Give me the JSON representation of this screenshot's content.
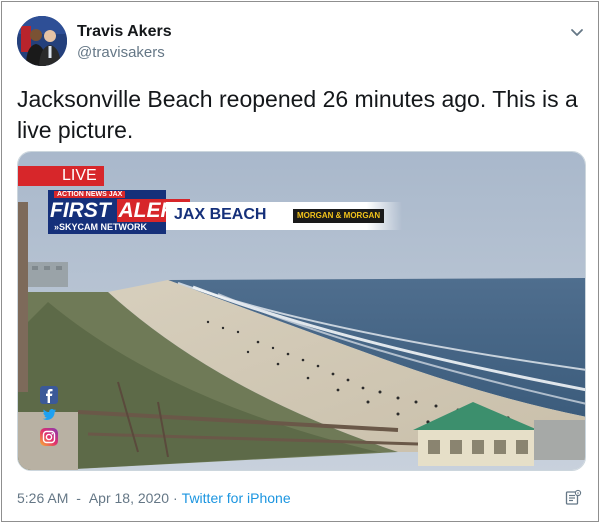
{
  "author": {
    "display_name": "Travis Akers",
    "handle": "@travisakers"
  },
  "tweet": {
    "text": "Jacksonville Beach reopened 26 minutes ago. This is a live picture."
  },
  "media": {
    "live_badge": "LIVE",
    "network_top": "ACTION NEWS JAX",
    "alert_word1": "FIRST",
    "alert_word2": "ALERT",
    "network_bottom": "»SKYCAM NETWORK",
    "location": "JAX BEACH",
    "sponsor": "MORGAN & MORGAN"
  },
  "footer": {
    "time": "5:26 AM",
    "date": "Apr 18, 2020",
    "separator": "·",
    "source": "Twitter for iPhone"
  },
  "colors": {
    "link": "#1b95e0",
    "secondary_text": "#657786",
    "live_red": "#d7262a",
    "alert_blue": "#15307a"
  },
  "icons": [
    "chevron-down-icon",
    "tweet-info-icon",
    "facebook-icon",
    "twitter-icon",
    "instagram-icon"
  ]
}
